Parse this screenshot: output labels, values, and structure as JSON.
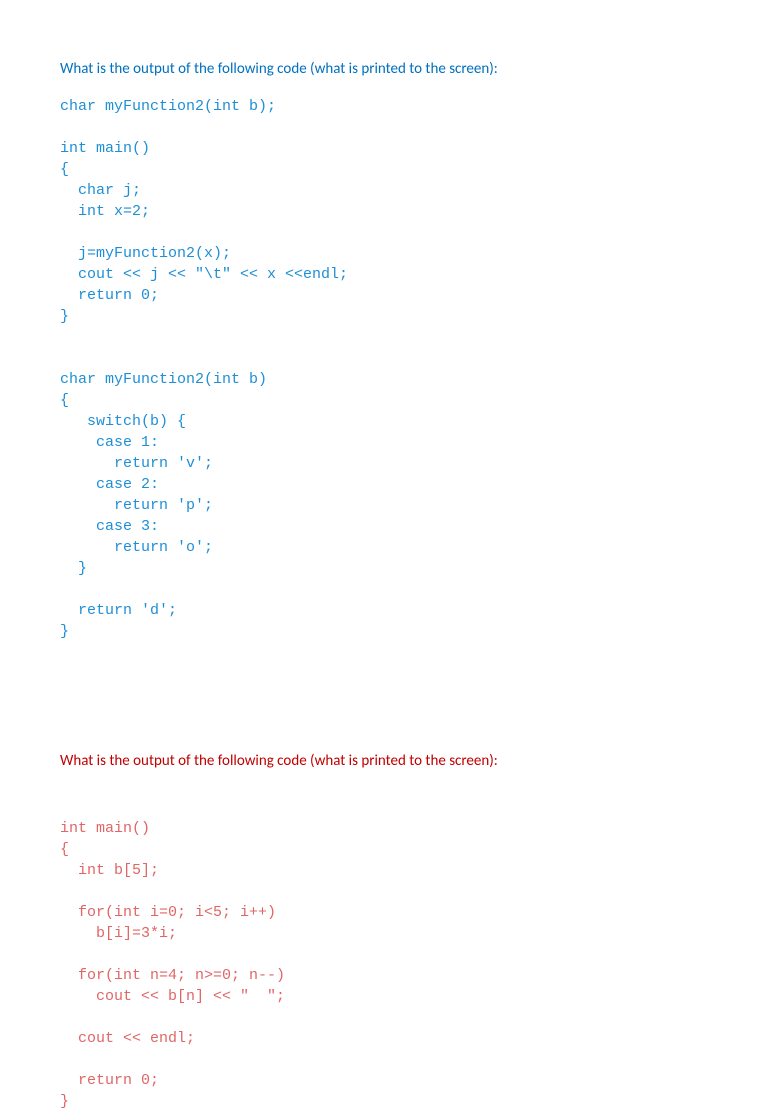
{
  "q1": {
    "prompt": "What is the output of the following code (what is printed to the screen):",
    "code": "char myFunction2(int b);\n\nint main()\n{\n  char j;\n  int x=2;\n\n  j=myFunction2(x);\n  cout << j << \"\\t\" << x <<endl;\n  return 0;\n}\n\n\nchar myFunction2(int b)\n{\n   switch(b) {\n    case 1:\n      return 'v';\n    case 2:\n      return 'p';\n    case 3:\n      return 'o';\n  }\n\n  return 'd';\n}"
  },
  "q2": {
    "prompt": "What is the output of the following code (what is printed to the screen):",
    "code": "int main()\n{\n  int b[5];\n\n  for(int i=0; i<5; i++)\n    b[i]=3*i;\n\n  for(int n=4; n>=0; n--)\n    cout << b[n] << \"  \";\n\n  cout << endl;\n\n  return 0;\n}"
  }
}
